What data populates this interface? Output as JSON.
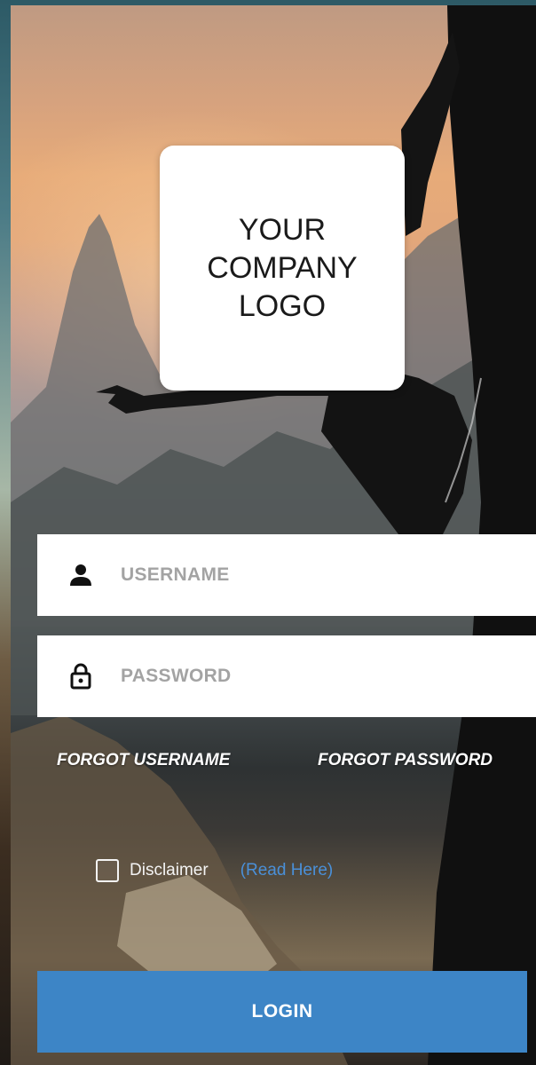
{
  "logo": {
    "text": "YOUR\nCOMPANY\nLOGO"
  },
  "username": {
    "placeholder": "USERNAME",
    "value": "",
    "icon": "person-icon"
  },
  "password": {
    "placeholder": "PASSWORD",
    "value": "",
    "icon": "lock-icon"
  },
  "links": {
    "forgot_username": "FORGOT USERNAME",
    "forgot_password": "FORGOT PASSWORD"
  },
  "disclaimer": {
    "label": "Disclaimer",
    "read_here": "(Read Here)",
    "checked": false
  },
  "login": {
    "label": "LOGIN"
  },
  "colors": {
    "accent": "#3d85c6",
    "link": "#4a90d9",
    "field_bg": "#ffffff",
    "placeholder": "#a3a3a3"
  }
}
